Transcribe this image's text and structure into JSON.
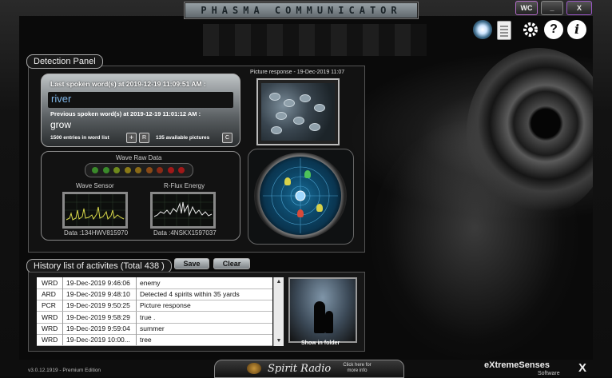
{
  "window": {
    "title": "PHASMA COMMUNICATOR",
    "wc_label": "WC",
    "minimize_label": "_",
    "close_label": "X"
  },
  "toolbar": {
    "icons": [
      "gear-spin-icon",
      "notepad-icon",
      "settings-icon",
      "help-icon",
      "info-icon"
    ],
    "help_label": "?",
    "info_label": "i"
  },
  "detection": {
    "panel_label": "Detection Panel",
    "last_spoken_label": "Last spoken word(s) at 2019-12-19 11:09:51 AM :",
    "last_word": "river",
    "previous_label": "Previous spoken word(s) at 2019-12-19 11:01:12 AM :",
    "previous_word": "grow",
    "entries_text": "1500 entries in word list",
    "plus_label": "+",
    "r_label": "R",
    "available_text": "135 available pictures",
    "c_label": "C",
    "picture_response_label": "Picture response - 19-Dec-2019 11:07",
    "wave_raw_title": "Wave Raw Data",
    "led_colors": [
      "#3a8a2a",
      "#3a8a2a",
      "#6e8a1c",
      "#8a7a16",
      "#8a6a16",
      "#8a4a16",
      "#8a2a16",
      "#a01818",
      "#a01818"
    ],
    "wave_sensor_label": "Wave Sensor",
    "rflux_label": "R-Flux Energy",
    "wave_sensor_data": "Data :134HWV815970",
    "rflux_data": "Data :4NSKX1597037"
  },
  "history": {
    "label": "History list of activites (Total 438 )",
    "save_label": "Save",
    "clear_label": "Clear",
    "rows": [
      {
        "type": "WRD",
        "time": "19-Dec-2019 9:46:06",
        "text": "enemy"
      },
      {
        "type": "ARD",
        "time": "19-Dec-2019 9:48:10",
        "text": "Detected 4 spirits within 35 yards"
      },
      {
        "type": "PCR",
        "time": "19-Dec-2019 9:50:25",
        "text": "Picture response"
      },
      {
        "type": "WRD",
        "time": "19-Dec-2019 9:58:29",
        "text": "true ."
      },
      {
        "type": "WRD",
        "time": "19-Dec-2019 9:59:04",
        "text": "summer"
      },
      {
        "type": "WRD",
        "time": "19-Dec-2019 10:00...",
        "text": "tree"
      }
    ],
    "show_in_folder": "Show in folder"
  },
  "footer": {
    "version": "v3.0.12.1919 - Premium Edition",
    "radio_name": "Spirit Radio",
    "radio_click": "Click here for more info",
    "brand": "eXtremeSenses",
    "brand_sub": "Software",
    "brand_x": "X"
  }
}
